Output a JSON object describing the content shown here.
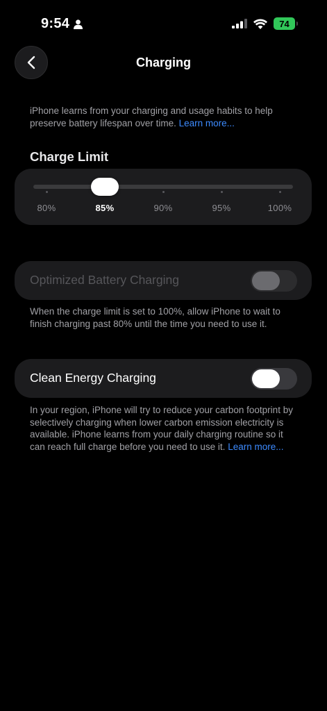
{
  "status_bar": {
    "time": "9:54",
    "battery_level": "74",
    "battery_color": "#31c759"
  },
  "nav": {
    "title": "Charging",
    "back_icon": "chevron-left-icon"
  },
  "intro": {
    "text": "iPhone learns from your charging and usage habits to help preserve battery lifespan over time. ",
    "link": "Learn more..."
  },
  "charge_limit": {
    "title": "Charge Limit",
    "options": [
      "80%",
      "85%",
      "90%",
      "95%",
      "100%"
    ],
    "selected_index": 1,
    "selected_value": "85%"
  },
  "optimized_charging": {
    "label": "Optimized Battery Charging",
    "enabled": false,
    "disabled_state": true,
    "description": "When the charge limit is set to 100%, allow iPhone to wait to finish charging past 80% until the time you need to use it."
  },
  "clean_energy": {
    "label": "Clean Energy Charging",
    "enabled": false,
    "description": "In your region, iPhone will try to reduce your carbon footprint by selectively charging when lower carbon emission electricity is available. iPhone learns from your daily charging routine so it can reach full charge before you need to use it. ",
    "link": "Learn more..."
  },
  "colors": {
    "accent_link": "#3d8bff",
    "card_bg": "#1c1c1e"
  }
}
